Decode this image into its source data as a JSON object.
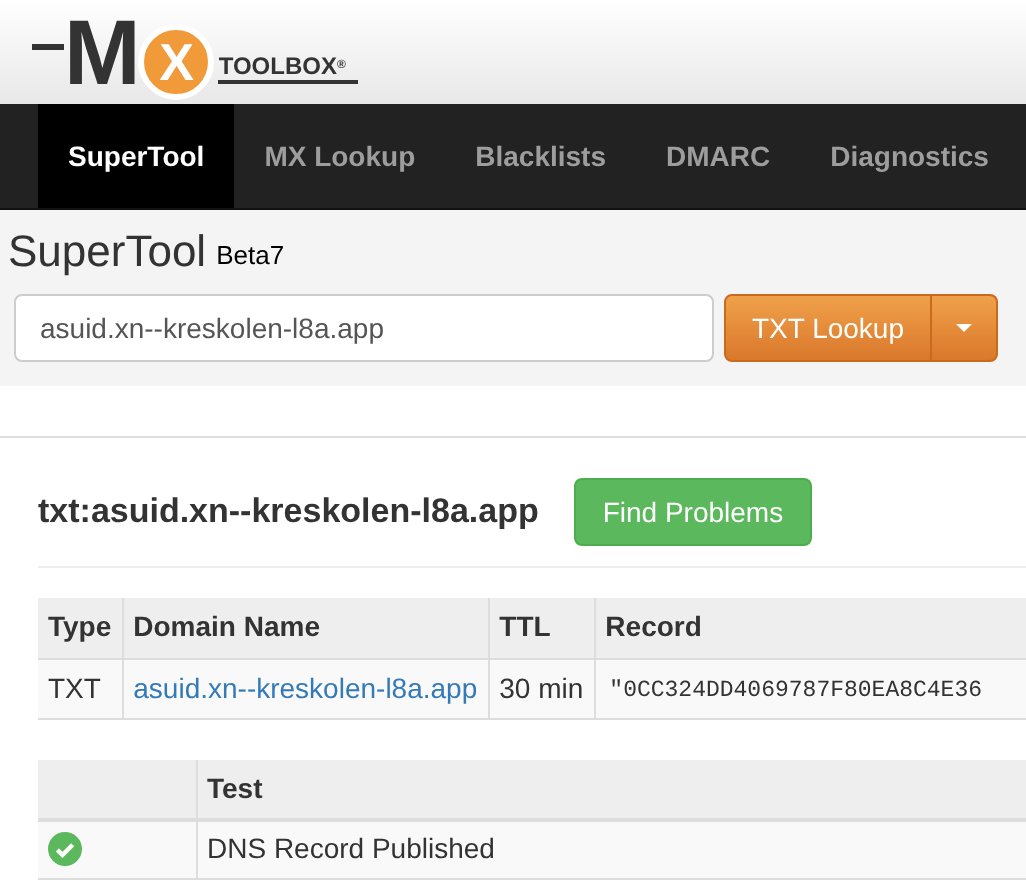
{
  "logo": {
    "letter_m": "M",
    "letter_x": "X",
    "wordmark": "TOOLBOX",
    "registered": "®"
  },
  "nav": [
    {
      "label": "SuperTool",
      "selected": true
    },
    {
      "label": "MX Lookup",
      "selected": false
    },
    {
      "label": "Blacklists",
      "selected": false
    },
    {
      "label": "DMARC",
      "selected": false
    },
    {
      "label": "Diagnostics",
      "selected": false
    }
  ],
  "tool": {
    "title": "SuperTool",
    "badge": "Beta7",
    "value": "asuid.xn--kreskolen-l8a.app",
    "button": "TXT Lookup"
  },
  "result": {
    "heading": "txt:asuid.xn--kreskolen-l8a.app",
    "button": "Find Problems"
  },
  "records": {
    "columns": [
      "Type",
      "Domain Name",
      "TTL",
      "Record"
    ],
    "rows": [
      {
        "type": "TXT",
        "domain": "asuid.xn--kreskolen-l8a.app",
        "ttl": "30 min",
        "record": "\"0CC324DD4069787F80EA8C4E36"
      }
    ]
  },
  "tests": {
    "columns": [
      "Test"
    ],
    "rows": [
      {
        "kind": "pass",
        "test": "DNS Record Published"
      }
    ]
  }
}
